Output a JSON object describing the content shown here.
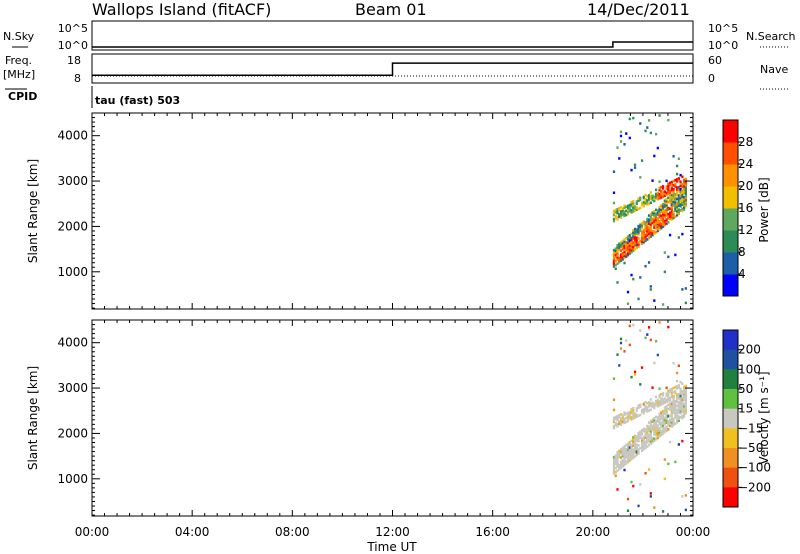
{
  "header": {
    "station": "Wallops Island (fitACF)",
    "beam": "Beam 01",
    "date": "14/Dec/2011"
  },
  "status_panels": {
    "nsky_label": "N.Sky",
    "nsky_ticks": [
      "10^5",
      "10^0"
    ],
    "nsearch_label": "N.Search",
    "nsearch_ticks": [
      "10^5",
      "10^0"
    ],
    "freq_label_1": "Freq.",
    "freq_label_2": "[MHz]",
    "freq_ticks": [
      "18",
      "8"
    ],
    "nave_label": "Nave",
    "nave_ticks": [
      "60",
      "0"
    ],
    "cpid_label": "CPID",
    "cpid_text": "tau (fast) 503"
  },
  "colors": {
    "power_scale": [
      "#0000ff",
      "#1c5fa8",
      "#2d8b57",
      "#5fa85f",
      "#f0c000",
      "#ff9000",
      "#ff5000",
      "#ff0000"
    ],
    "velocity_scale": [
      "#2030c8",
      "#2050a0",
      "#208040",
      "#60c040",
      "#c8c8c0",
      "#f0c020",
      "#f09020",
      "#f05010",
      "#ff0000"
    ],
    "frame": "#000000"
  },
  "chart_data": [
    {
      "type": "heatmap",
      "title": "",
      "xlabel": "Time UT",
      "ylabel": "Slant Range [km]",
      "colorbar_label": "Power [dB]",
      "colorbar_ticks": [
        "4",
        "8",
        "12",
        "16",
        "20",
        "24",
        "28"
      ],
      "x_ticks": [
        "00:00",
        "04:00",
        "08:00",
        "12:00",
        "16:00",
        "20:00",
        "00:00"
      ],
      "y_ticks": [
        "1000",
        "2000",
        "3000",
        "4000"
      ],
      "xlim": [
        0,
        24
      ],
      "ylim": [
        180,
        4500
      ],
      "grid": false,
      "echo_regions": [
        {
          "t_start": 20.8,
          "t_end": 23.7,
          "range_start": 1100,
          "range_end": 3050,
          "power_db": "4-28"
        }
      ]
    },
    {
      "type": "heatmap",
      "title": "",
      "xlabel": "Time UT",
      "ylabel": "Slant Range [km]",
      "colorbar_label": "Velocity [m s⁻¹]",
      "colorbar_ticks": [
        "200",
        "100",
        "50",
        "15",
        "−15",
        "−50",
        "−100",
        "−200"
      ],
      "x_ticks": [
        "00:00",
        "04:00",
        "08:00",
        "12:00",
        "16:00",
        "20:00",
        "00:00"
      ],
      "y_ticks": [
        "1000",
        "2000",
        "3000",
        "4000"
      ],
      "xlim": [
        0,
        24
      ],
      "ylim": [
        180,
        4500
      ],
      "grid": false,
      "echo_regions": [
        {
          "t_start": 20.8,
          "t_end": 23.7,
          "range_start": 1100,
          "range_end": 3050,
          "velocity_ms": "-15 to 15"
        }
      ]
    }
  ],
  "frequency_steps": [
    {
      "t_start": 0.0,
      "t_end": 12.0,
      "freq_mhz": 10.5
    },
    {
      "t_start": 12.0,
      "t_end": 24.0,
      "freq_mhz": 15.0
    }
  ],
  "nsky_steps": [
    {
      "t_start": 0.0,
      "t_end": 20.8,
      "value": 1
    },
    {
      "t_start": 20.8,
      "t_end": 24.0,
      "value": 30
    }
  ]
}
